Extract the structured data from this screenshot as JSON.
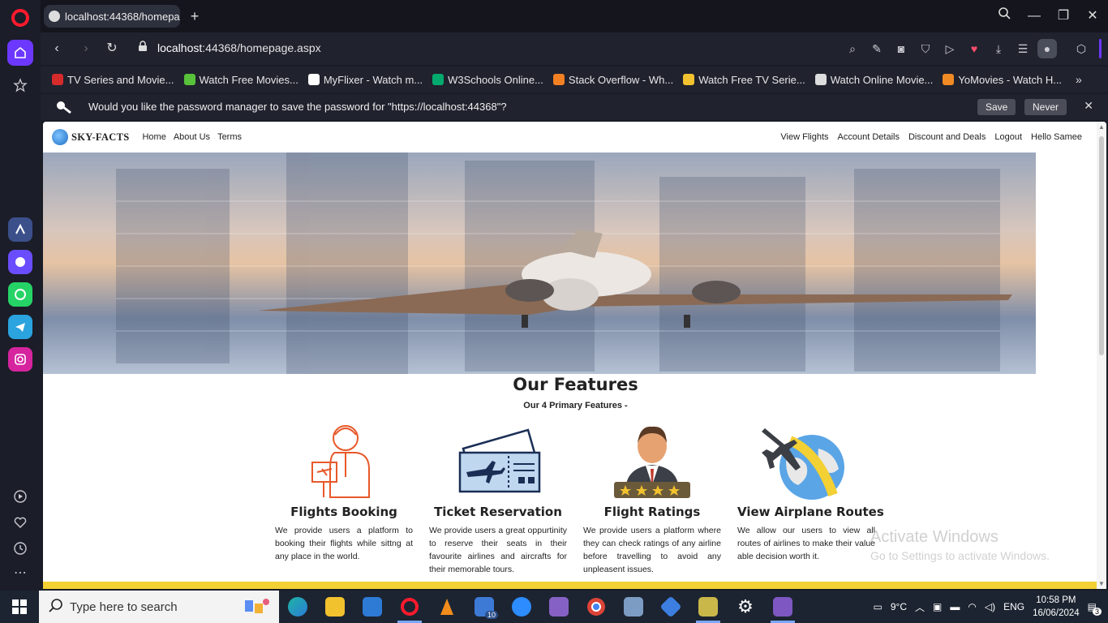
{
  "browser": {
    "tab_title": "localhost:44368/homepage.aspx",
    "url_host": "localhost",
    "url_rest": ":44368/homepage.aspx",
    "bookmarks": [
      {
        "label": "TV Series and Movie...",
        "color": "#d62b2b"
      },
      {
        "label": "Watch Free Movies...",
        "color": "#58c23b"
      },
      {
        "label": "MyFlixer - Watch m...",
        "color": "#ffffff"
      },
      {
        "label": "W3Schools Online...",
        "color": "#04aa6d"
      },
      {
        "label": "Stack Overflow - Wh...",
        "color": "#f48024"
      },
      {
        "label": "Watch Free TV Serie...",
        "color": "#f2c230"
      },
      {
        "label": "Watch Online Movie...",
        "color": "#dddddd"
      },
      {
        "label": "YoMovies - Watch H...",
        "color": "#f08a24"
      }
    ],
    "password_prompt": {
      "text": "Would you like the password manager to save the password for \"https://localhost:44368\"?",
      "save": "Save",
      "never": "Never"
    }
  },
  "site": {
    "brand": "SKY-FACTS",
    "nav_left": [
      "Home",
      "About Us",
      "Terms"
    ],
    "nav_right": [
      "View Flights",
      "Account Details",
      "Discount and Deals",
      "Logout",
      "Hello Samee"
    ],
    "features_title": "Our Features",
    "features_subtitle": "Our 4 Primary Features -",
    "features": [
      {
        "title": "Flights Booking",
        "text": "We provide users a platform to booking their flights while sittng at any place in the world.",
        "icon": "agent-icon"
      },
      {
        "title": "Ticket Reservation",
        "text": "We provide users a great oppurtinity to reserve their seats in their favourite airlines and aircrafts for their memorable tours.",
        "icon": "ticket-icon"
      },
      {
        "title": "Flight Ratings",
        "text": "We provide users a platform where they can check ratings of any airline before travelling to avoid any unpleasent issues.",
        "icon": "rating-icon"
      },
      {
        "title": "View Airplane Routes",
        "text": "We allow our users to view all routes of airlines to make their value able decision worth it.",
        "icon": "globe-plane-icon"
      }
    ]
  },
  "watermark": {
    "line1": "Activate Windows",
    "line2": "Go to Settings to activate Windows."
  },
  "taskbar": {
    "search_placeholder": "Type here to search",
    "weather": "9°C",
    "lang": "ENG",
    "time": "10:58 PM",
    "date": "16/06/2024",
    "mail_badge": "10",
    "notif_count": "3"
  }
}
